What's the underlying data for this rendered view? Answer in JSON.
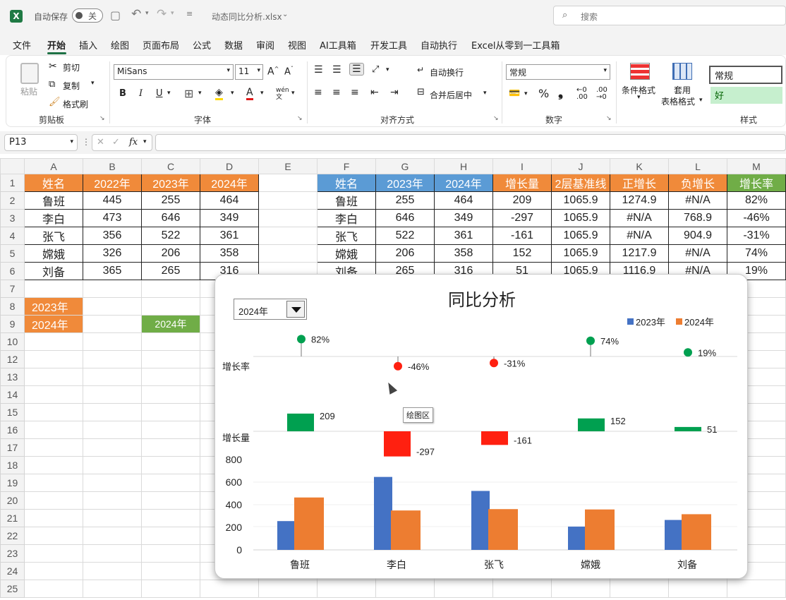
{
  "titlebar": {
    "autosave_label": "自动保存",
    "autosave_state": "关",
    "filename": "动态同比分析.xlsx",
    "search_placeholder": "搜索"
  },
  "menu": [
    "文件",
    "开始",
    "插入",
    "绘图",
    "页面布局",
    "公式",
    "数据",
    "审阅",
    "视图",
    "AI工具箱",
    "开发工具",
    "自动执行",
    "Excel从零到一工具箱"
  ],
  "ribbon": {
    "clipboard": {
      "paste": "粘贴",
      "cut": "剪切",
      "copy": "复制",
      "format_painter": "格式刷",
      "label": "剪贴板"
    },
    "font": {
      "name": "MiSans",
      "size": "11",
      "label": "字体",
      "bold": "B",
      "italic": "I",
      "underline": "U"
    },
    "align": {
      "wrap": "自动换行",
      "merge": "合并后居中",
      "label": "对齐方式"
    },
    "number": {
      "format": "常规",
      "label": "数字"
    },
    "styles": {
      "cond_format": "条件格式",
      "table_format_1": "套用",
      "table_format_2": "表格格式",
      "normal": "常规",
      "good": "好",
      "label": "样式"
    }
  },
  "formula_bar": {
    "name_box": "P13",
    "fx": "fx",
    "formula": ""
  },
  "sheet": {
    "columns": [
      "A",
      "B",
      "C",
      "D",
      "E",
      "F",
      "G",
      "H",
      "I",
      "J",
      "K",
      "L",
      "M"
    ],
    "rows": [
      {
        "n": "1",
        "cells": [
          "姓名",
          "2022年",
          "2023年",
          "2024年",
          "",
          "姓名",
          "2023年",
          "2024年",
          "增长量",
          "2层基准线",
          "正增长",
          "负增长",
          "增长率"
        ]
      },
      {
        "n": "2",
        "cells": [
          "鲁班",
          "445",
          "255",
          "464",
          "",
          "鲁班",
          "255",
          "464",
          "209",
          "1065.9",
          "1274.9",
          "#N/A",
          "82%"
        ]
      },
      {
        "n": "3",
        "cells": [
          "李白",
          "473",
          "646",
          "349",
          "",
          "李白",
          "646",
          "349",
          "-297",
          "1065.9",
          "#N/A",
          "768.9",
          "-46%"
        ]
      },
      {
        "n": "4",
        "cells": [
          "张飞",
          "356",
          "522",
          "361",
          "",
          "张飞",
          "522",
          "361",
          "-161",
          "1065.9",
          "#N/A",
          "904.9",
          "-31%"
        ]
      },
      {
        "n": "5",
        "cells": [
          "嫦娥",
          "326",
          "206",
          "358",
          "",
          "嫦娥",
          "206",
          "358",
          "152",
          "1065.9",
          "1217.9",
          "#N/A",
          "74%"
        ]
      },
      {
        "n": "6",
        "cells": [
          "刘备",
          "365",
          "265",
          "316",
          "",
          "刘备",
          "265",
          "316",
          "51",
          "1065.9",
          "1116.9",
          "#N/A",
          "19%"
        ]
      },
      {
        "n": "7",
        "cells": [
          "",
          "",
          "",
          "",
          "",
          "",
          "",
          "",
          "",
          "",
          "",
          "",
          ""
        ]
      },
      {
        "n": "8",
        "cells": [
          "2023年",
          "",
          "",
          "",
          "",
          "",
          "",
          "",
          "",
          "",
          "",
          "",
          ""
        ]
      },
      {
        "n": "9",
        "cells": [
          "2024年",
          "",
          "2024年",
          "",
          "",
          "",
          "",
          "",
          "",
          "",
          "",
          "",
          ""
        ]
      },
      {
        "n": "10",
        "cells": [
          "",
          "",
          "",
          "",
          "",
          "",
          "",
          "",
          "",
          "",
          "",
          "",
          ""
        ]
      },
      {
        "n": "12",
        "cells": [
          "",
          "",
          "",
          "",
          "",
          "",
          "",
          "",
          "",
          "",
          "",
          "",
          ""
        ]
      },
      {
        "n": "13",
        "cells": [
          "",
          "",
          "",
          "",
          "",
          "",
          "",
          "",
          "",
          "",
          "",
          "",
          ""
        ]
      },
      {
        "n": "14",
        "cells": [
          "",
          "",
          "",
          "",
          "",
          "",
          "",
          "",
          "",
          "",
          "",
          "",
          ""
        ]
      },
      {
        "n": "15",
        "cells": [
          "",
          "",
          "",
          "",
          "",
          "",
          "",
          "",
          "",
          "",
          "",
          "",
          ""
        ]
      },
      {
        "n": "16",
        "cells": [
          "",
          "",
          "",
          "",
          "",
          "",
          "",
          "",
          "",
          "",
          "",
          "",
          ""
        ]
      },
      {
        "n": "17",
        "cells": [
          "",
          "",
          "",
          "",
          "",
          "",
          "",
          "",
          "",
          "",
          "",
          "",
          ""
        ]
      },
      {
        "n": "18",
        "cells": [
          "",
          "",
          "",
          "",
          "",
          "",
          "",
          "",
          "",
          "",
          "",
          "",
          ""
        ]
      },
      {
        "n": "19",
        "cells": [
          "",
          "",
          "",
          "",
          "",
          "",
          "",
          "",
          "",
          "",
          "",
          "",
          ""
        ]
      },
      {
        "n": "20",
        "cells": [
          "",
          "",
          "",
          "",
          "",
          "",
          "",
          "",
          "",
          "",
          "",
          "",
          ""
        ]
      },
      {
        "n": "21",
        "cells": [
          "",
          "",
          "",
          "",
          "",
          "",
          "",
          "",
          "",
          "",
          "",
          "",
          ""
        ]
      },
      {
        "n": "22",
        "cells": [
          "",
          "",
          "",
          "",
          "",
          "",
          "",
          "",
          "",
          "",
          "",
          "",
          ""
        ]
      },
      {
        "n": "23",
        "cells": [
          "",
          "",
          "",
          "",
          "",
          "",
          "",
          "",
          "",
          "",
          "",
          "",
          ""
        ]
      },
      {
        "n": "24",
        "cells": [
          "",
          "",
          "",
          "",
          "",
          "",
          "",
          "",
          "",
          "",
          "",
          "",
          ""
        ]
      },
      {
        "n": "25",
        "cells": [
          "",
          "",
          "",
          "",
          "",
          "",
          "",
          "",
          "",
          "",
          "",
          "",
          ""
        ]
      }
    ]
  },
  "chart_data": {
    "type": "bar",
    "title": "同比分析",
    "dropdown_value": "2024年",
    "categories": [
      "鲁班",
      "李白",
      "张飞",
      "嫦娥",
      "刘备"
    ],
    "series": [
      {
        "name": "2023年",
        "values": [
          255,
          646,
          522,
          206,
          265
        ],
        "color": "#4472c4"
      },
      {
        "name": "2024年",
        "values": [
          464,
          349,
          361,
          358,
          316
        ],
        "color": "#ed7d31"
      }
    ],
    "growth_amount": {
      "label": "增长量",
      "values": [
        209,
        -297,
        -161,
        152,
        51
      ],
      "labels": [
        "209",
        "-297",
        "-161",
        "152",
        "51"
      ]
    },
    "growth_rate": {
      "label": "增长率",
      "values": [
        0.82,
        -0.46,
        -0.31,
        0.74,
        0.19
      ],
      "labels": [
        "82%",
        "-46%",
        "-31%",
        "74%",
        "19%"
      ]
    },
    "yticks": [
      "800",
      "600",
      "400",
      "200",
      "0"
    ],
    "ylim": [
      0,
      800
    ],
    "legend_position": "top-right",
    "positive_color": "#00a050",
    "negative_color": "#ff2010",
    "tooltip": "绘图区"
  }
}
